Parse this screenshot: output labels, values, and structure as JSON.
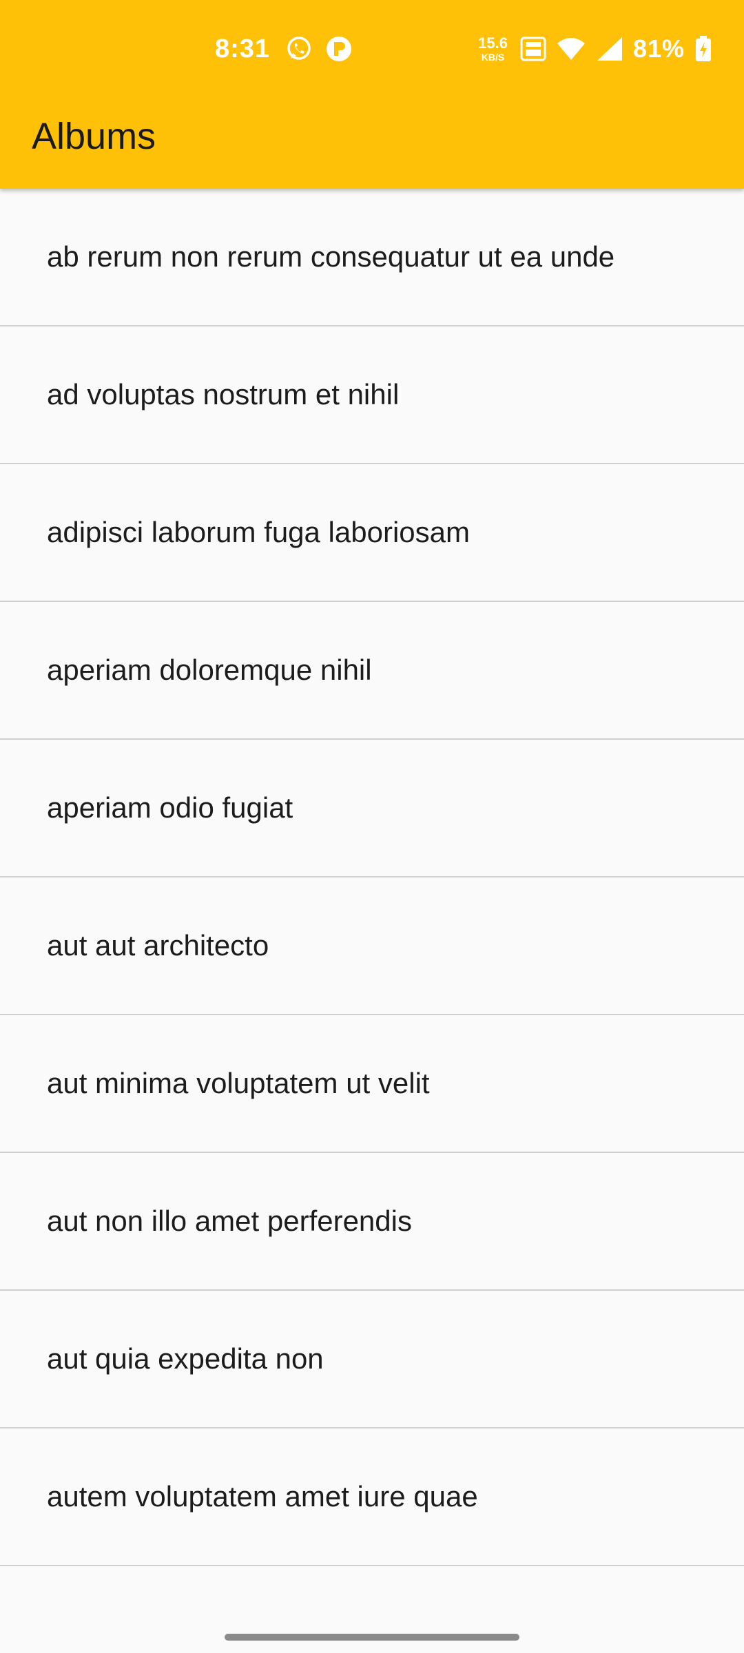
{
  "status_bar": {
    "time": "8:31",
    "net_speed_value": "15.6",
    "net_speed_unit": "KB/S",
    "battery": "81%",
    "icons": [
      "whatsapp-icon",
      "notification-app-icon",
      "volte-icon",
      "wifi-icon",
      "cell-signal-icon",
      "battery-charging-icon"
    ]
  },
  "appbar": {
    "title": "Albums",
    "color": "#ffc107"
  },
  "albums": [
    "ab rerum non rerum consequatur ut ea unde",
    "ad voluptas nostrum et nihil",
    "adipisci laborum fuga laboriosam",
    "aperiam doloremque nihil",
    "aperiam odio fugiat",
    "aut aut architecto",
    "aut minima voluptatem ut velit",
    "aut non illo amet perferendis",
    "aut quia expedita non",
    "autem voluptatem amet iure quae"
  ]
}
